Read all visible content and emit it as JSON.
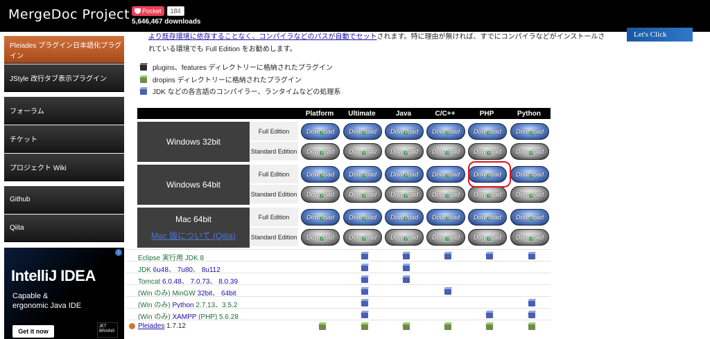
{
  "header": {
    "title": "MergeDoc Project",
    "pocket_label": "Pocket",
    "pocket_count": "184",
    "downloads": "5,646,467 downloads"
  },
  "sidebar": {
    "items": [
      {
        "label": "Pleiades プラグイン日本語化プラグイン",
        "active": true
      },
      {
        "label": "JStyle 改行タブ表示プラグイン",
        "active": false
      },
      {
        "label": "フォーラム",
        "active": false
      },
      {
        "label": "チケット",
        "active": false
      },
      {
        "label": "プロジェクト Wiki",
        "active": false
      },
      {
        "label": "Github",
        "active": false
      },
      {
        "label": "Qiita",
        "active": false
      }
    ]
  },
  "ad": {
    "title": "IntelliJ IDEA",
    "subtitle1": "Capable &",
    "subtitle2": "ergonomic Java IDE",
    "button": "Get it now",
    "logo_line1": "JET",
    "logo_line2": "BRAINS"
  },
  "banner": {
    "label": "Let's Click"
  },
  "intro": {
    "line1_link": "より既存環境に依存することなく、コンパイラなどのパスが自動でセット",
    "line1_rest": "されます。特に理由が無ければ、すでにコンパイラなどがインストールさ",
    "line2": "れている環境でも Full Edition をお勧めします。"
  },
  "legend": [
    {
      "icon": "dark-cube-icon",
      "label": "plugins、features ディレクトリーに格納されたプラグイン"
    },
    {
      "icon": "green-cube-icon",
      "label": "dropins ディレクトリーに格納されたプラグイン"
    },
    {
      "icon": "blue-cube-icon",
      "label": "JDK などの各言語のコンパイラー、ランタイムなどの処理系"
    }
  ],
  "table": {
    "columns": [
      "Platform",
      "Ultimate",
      "Java",
      "C/C++",
      "PHP",
      "Python"
    ],
    "button_label": "Download",
    "full_edition": "Full Edition",
    "standard_edition": "Standard Edition",
    "os": [
      {
        "name": "Windows 32bit",
        "link": ""
      },
      {
        "name": "Windows 64bit",
        "link": ""
      },
      {
        "name": "Mac 64bit",
        "link": "Mac 版について (Qiita)"
      }
    ]
  },
  "components": [
    {
      "label": "Eclipse 実行用 JDK 8",
      "icon": "blue",
      "cols": [
        false,
        true,
        true,
        true,
        true,
        true
      ]
    },
    {
      "label_prefix": "JDK ",
      "links": [
        "6u48",
        "7u80",
        "8u112"
      ],
      "icon": "blue",
      "cols": [
        false,
        true,
        true,
        false,
        false,
        false
      ]
    },
    {
      "label_prefix": "Tomcat ",
      "links": [
        "6.0.48",
        "7.0.73",
        "8.0.39"
      ],
      "icon": "blue",
      "cols": [
        false,
        true,
        true,
        false,
        false,
        false
      ]
    },
    {
      "label_prefix": "(Win のみ) MinGW ",
      "links": [
        "32bit",
        "64bit"
      ],
      "icon": "blue",
      "cols": [
        false,
        true,
        false,
        true,
        false,
        false
      ]
    },
    {
      "label_prefix": "(Win のみ) ",
      "links": [
        "Python"
      ],
      "label_suffix": " 2.7.13、3.5.2",
      "icon": "blue",
      "cols": [
        false,
        true,
        false,
        false,
        false,
        true
      ]
    },
    {
      "label_prefix": "(Win のみ) ",
      "links": [
        "XAMPP"
      ],
      "label_suffix": " (PHP) 5.6.28",
      "icon": "blue",
      "cols": [
        false,
        true,
        false,
        false,
        true,
        true
      ]
    },
    {
      "links": [
        "Pleiades"
      ],
      "label_suffix": " 1.7.12",
      "icon": "green",
      "cols": [
        true,
        true,
        true,
        true,
        true,
        true
      ]
    }
  ]
}
